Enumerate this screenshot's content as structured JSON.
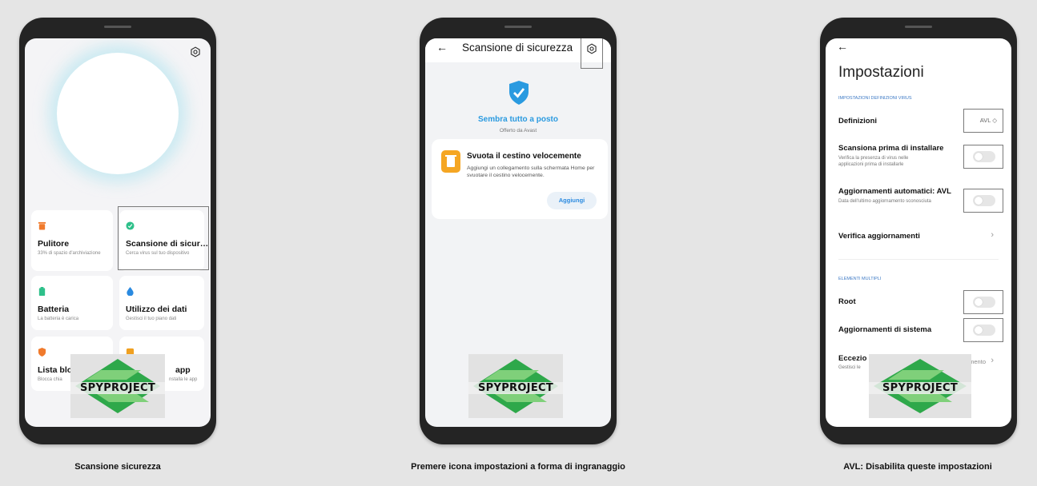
{
  "captions": [
    "Scansione sicurezza",
    "Premere icona impostazioni a forma di ingranaggio",
    "AVL: Disabilita queste impostazioni"
  ],
  "watermark": "SPYPROJECT",
  "phone1": {
    "cards": [
      {
        "title": "Pulitore",
        "subtitle": "33% di spazio d'archiviazione",
        "icon": "trash-icon",
        "color": "#f07a2c"
      },
      {
        "title": "Scansione di sicur…",
        "subtitle": "Cerca virus sul tuo dispositivo",
        "icon": "shield-check-icon",
        "color": "#2ec08a"
      },
      {
        "title": "Batteria",
        "subtitle": "La batteria è carica",
        "icon": "battery-icon",
        "color": "#2ec08a"
      },
      {
        "title": "Utilizzo dei dati",
        "subtitle": "Gestisci il tuo piano dati",
        "icon": "water-drop-icon",
        "color": "#2a8ae0"
      },
      {
        "title": "Lista bloc",
        "subtitle": "Blocca chia",
        "icon": "shield-icon",
        "color": "#f07a2c"
      },
      {
        "title": "app",
        "subtitle": "nstalla le app",
        "icon": "app-icon",
        "color": "#f0a020"
      }
    ]
  },
  "phone2": {
    "title": "Scansione di sicurezza",
    "status": "Sembra tutto a posto",
    "offered_by": "Offerto da Avast",
    "card": {
      "title": "Svuota il cestino velocemente",
      "description": "Aggiungi un collegamento sulla schermata Home per svuotare il cestino velocemente.",
      "button": "Aggiungi"
    },
    "accent": "#2a9ae0"
  },
  "phone3": {
    "title": "Impostazioni",
    "section1": "IMPOSTAZIONI DEFINIZIONI VIRUS",
    "definizioni_label": "Definizioni",
    "definizioni_value": "AVL ◇",
    "scan_install_title": "Scansiona prima di installare",
    "scan_install_sub": "Verifica la presenza di virus nelle applicazioni prima di installarle",
    "auto_update_title": "Aggiornamenti automatici: AVL",
    "auto_update_sub": "Data dell'ultimo aggiornamento sconosciuta",
    "check_updates": "Verifica aggiornamenti",
    "section2": "ELEMENTI MULTIPLI",
    "root": "Root",
    "system_updates": "Aggiornamenti di sistema",
    "exceptions_title": "Eccezio",
    "exceptions_sub": "Gestisci le",
    "exceptions_tail": "mento"
  }
}
